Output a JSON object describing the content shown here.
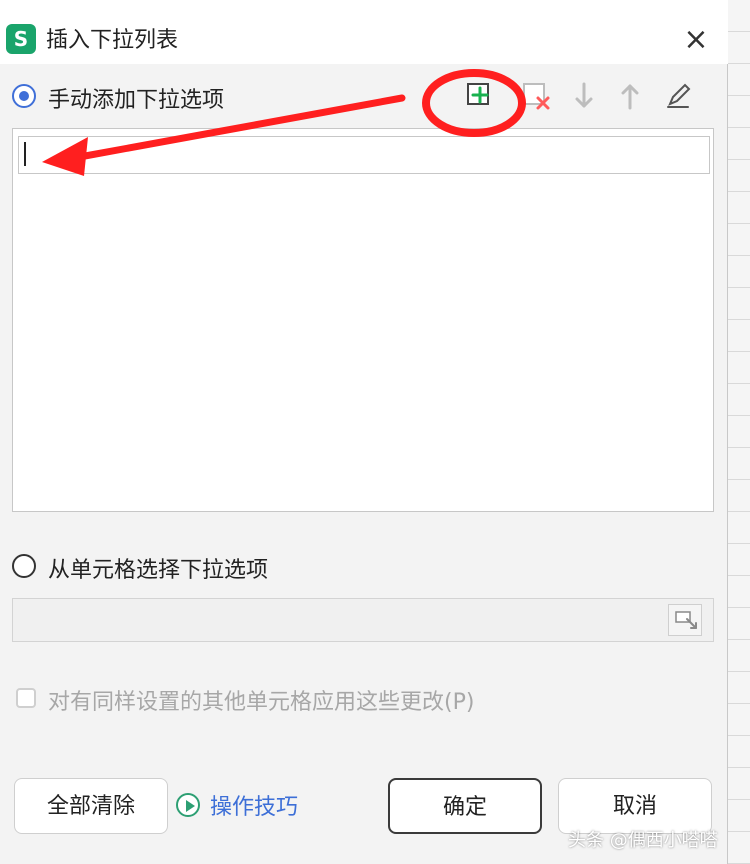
{
  "dialog": {
    "app_icon_letter": "S",
    "title": "插入下拉列表"
  },
  "manual_section": {
    "label": "手动添加下拉选项",
    "selected": true
  },
  "from_cells_section": {
    "label": "从单元格选择下拉选项",
    "selected": false
  },
  "apply_all": {
    "label": "对有同样设置的其他单元格应用这些更改(P)",
    "checked": false
  },
  "buttons": {
    "clear_all": "全部清除",
    "ok": "确定",
    "cancel": "取消"
  },
  "tips": {
    "label": "操作技巧"
  },
  "watermark": "头条 @偶西小嗒嗒",
  "colors": {
    "accent": "#3f6fd8",
    "annotation_red": "#ff1f1f",
    "app_green": "#1aa46b"
  },
  "icons": [
    "add-item-icon",
    "delete-item-icon",
    "move-down-icon",
    "move-up-icon",
    "edit-item-icon",
    "close-icon",
    "cell-range-picker-icon"
  ]
}
